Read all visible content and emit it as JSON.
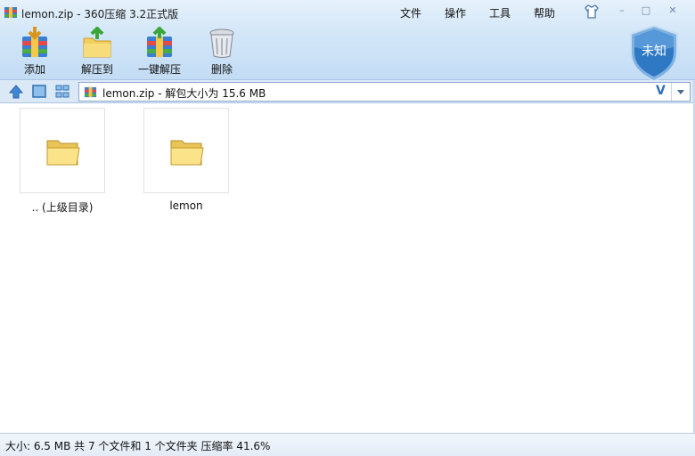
{
  "window": {
    "title": "lemon.zip - 360压缩 3.2正式版",
    "menu": [
      "文件",
      "操作",
      "工具",
      "帮助"
    ],
    "minimize": "–",
    "restore": "□",
    "close": "✕"
  },
  "toolbar": {
    "add": "添加",
    "extract_to": "解压到",
    "one_click_extract": "一键解压",
    "delete": "删除"
  },
  "security": {
    "status": "未知"
  },
  "address": {
    "text": "lemon.zip - 解包大小为 15.6 MB",
    "verify": "V"
  },
  "files": [
    {
      "name": ".. (上级目录)",
      "icon": "folder-icon"
    },
    {
      "name": "lemon",
      "icon": "folder-icon"
    }
  ],
  "status": {
    "text": "大小: 6.5 MB 共 7 个文件和 1 个文件夹 压缩率 41.6%"
  },
  "colors": {
    "accent": "#2f6fb4",
    "toolbar_bg": "#d2e6f8",
    "folder": "#f3d56a"
  }
}
